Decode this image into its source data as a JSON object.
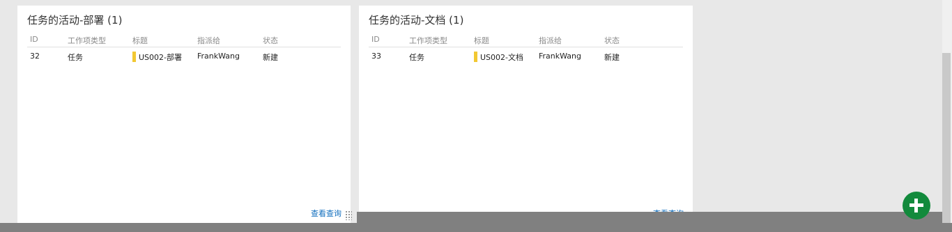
{
  "widgets": [
    {
      "title": "任务的活动-部署 (1)",
      "columns": [
        "ID",
        "工作项类型",
        "标题",
        "指派给",
        "状态"
      ],
      "rows": [
        {
          "id": "32",
          "type": "任务",
          "title": "US002-部署",
          "assigned": "FrankWang",
          "state": "新建"
        }
      ],
      "footer_link": "查看查询"
    },
    {
      "title": "任务的活动-文档 (1)",
      "columns": [
        "ID",
        "工作项类型",
        "标题",
        "指派给",
        "状态"
      ],
      "rows": [
        {
          "id": "33",
          "type": "任务",
          "title": "US002-文档",
          "assigned": "FrankWang",
          "state": "新建"
        }
      ],
      "footer_link": "查看查询"
    }
  ],
  "colors": {
    "background": "#e8e8e8",
    "widget_bg": "#ffffff",
    "title_bar": "#f2c832",
    "link": "#106ebe",
    "fab": "#128a3c"
  },
  "icons": {
    "fab": "plus-icon",
    "resize": "resize-grip-icon"
  }
}
